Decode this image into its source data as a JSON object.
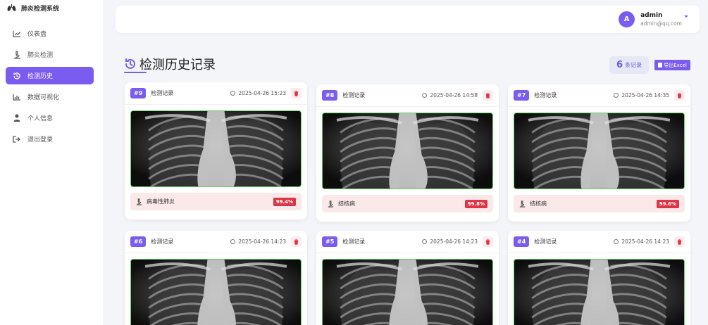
{
  "app": {
    "title": "肺炎检测系统"
  },
  "sidebar": {
    "items": [
      {
        "label": "仪表盘",
        "icon": "chart-line-icon",
        "active": false
      },
      {
        "label": "肺炎检测",
        "icon": "microscope-icon",
        "active": false
      },
      {
        "label": "检测历史",
        "icon": "history-icon",
        "active": true
      },
      {
        "label": "数据可视化",
        "icon": "bar-chart-icon",
        "active": false
      },
      {
        "label": "个人信息",
        "icon": "user-icon",
        "active": false
      },
      {
        "label": "退出登录",
        "icon": "logout-icon",
        "active": false
      }
    ]
  },
  "header": {
    "avatar_letter": "A",
    "username": "admin",
    "email": "admin@qq.com"
  },
  "page": {
    "title": "检测历史记录",
    "count": "6",
    "count_label": "条记录",
    "export_label": "导出Excel"
  },
  "records": [
    {
      "id": "#9",
      "label": "检测记录",
      "time": "2025-04-26 15:23",
      "result": "病毒性肺炎",
      "confidence": "99.4%"
    },
    {
      "id": "#8",
      "label": "检测记录",
      "time": "2025-04-26 14:58",
      "result": "结核病",
      "confidence": "99.8%"
    },
    {
      "id": "#7",
      "label": "检测记录",
      "time": "2025-04-26 14:35",
      "result": "结核病",
      "confidence": "99.6%"
    },
    {
      "id": "#6",
      "label": "检测记录",
      "time": "2025-04-26 14:23",
      "result": "",
      "confidence": ""
    },
    {
      "id": "#5",
      "label": "检测记录",
      "time": "2025-04-26 14:23",
      "result": "",
      "confidence": ""
    },
    {
      "id": "#4",
      "label": "检测记录",
      "time": "2025-04-26 14:23",
      "result": "",
      "confidence": ""
    }
  ],
  "colors": {
    "accent": "#7b5cf0",
    "danger": "#dc3545",
    "success_border": "#5fd35f",
    "result_bg": "#fbe9ea"
  }
}
